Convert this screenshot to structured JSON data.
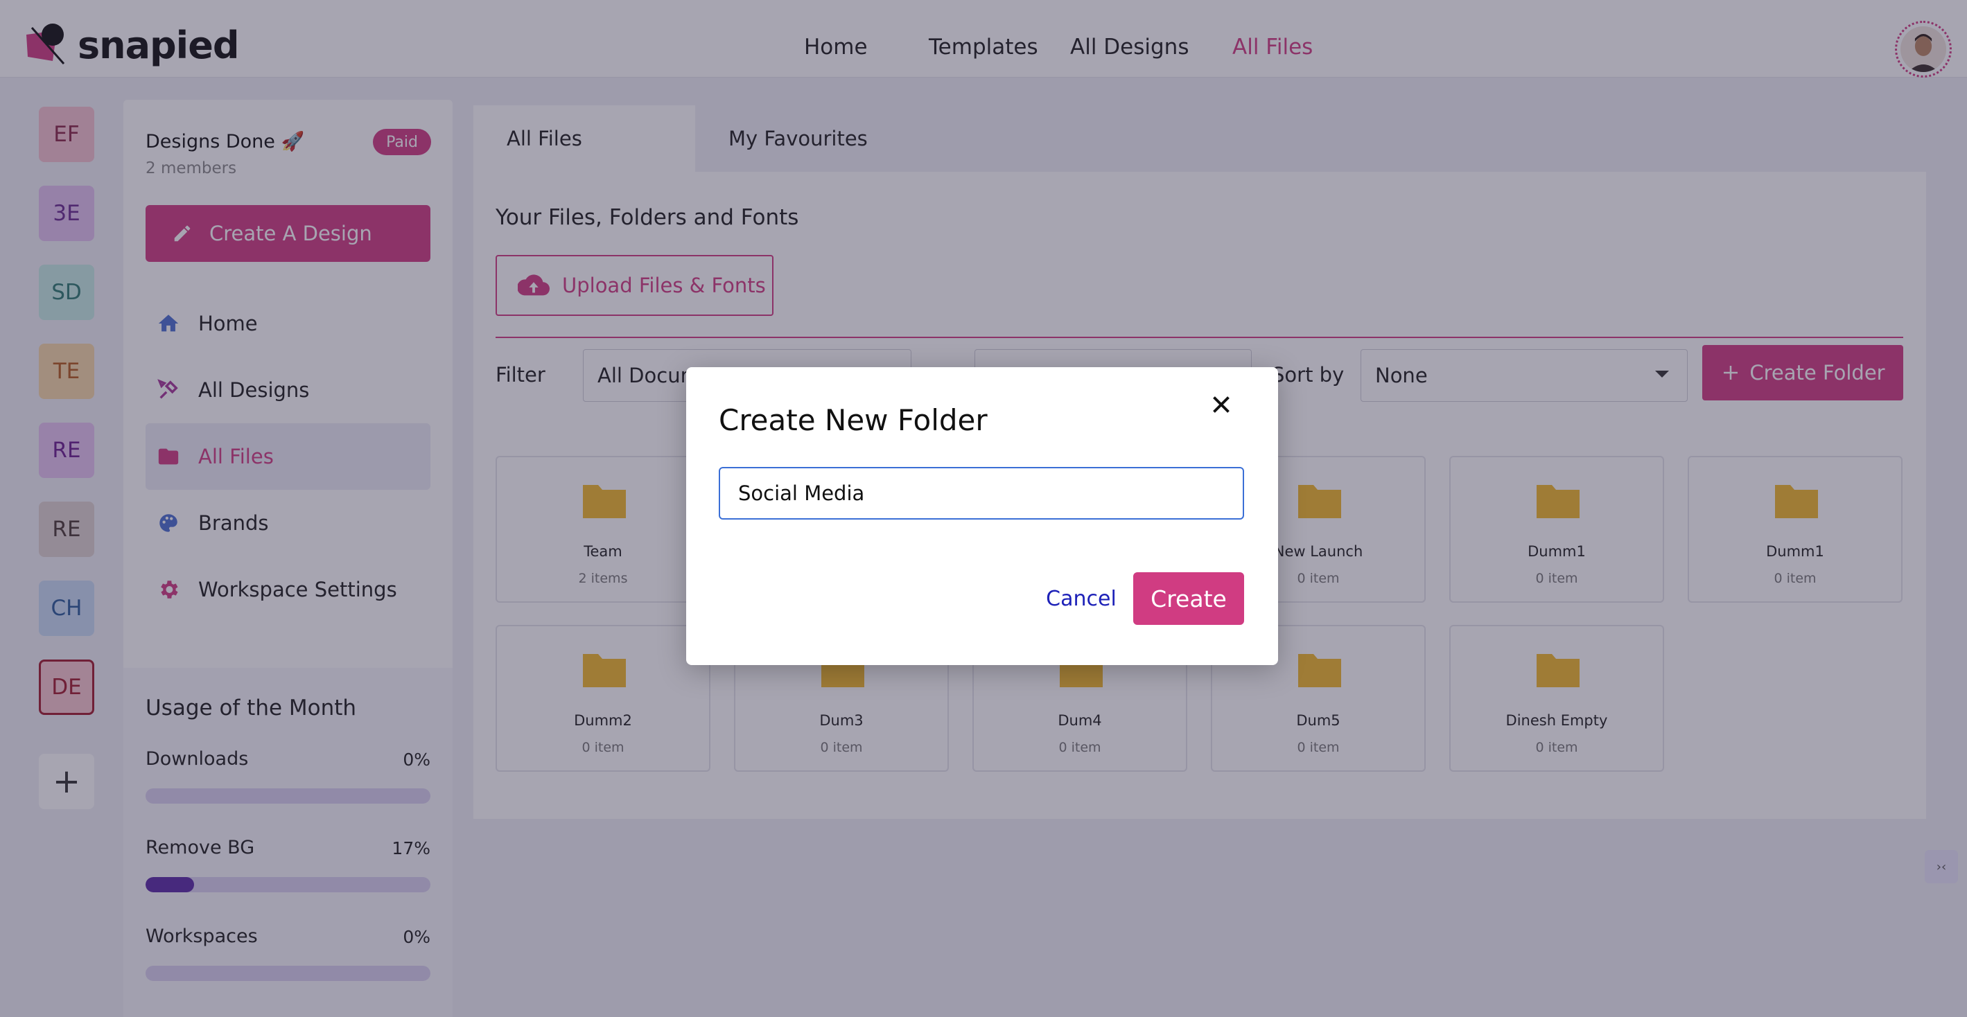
{
  "brand": {
    "name": "snapied"
  },
  "nav": {
    "links": [
      "Home",
      "Templates",
      "All Designs",
      "All Files"
    ],
    "active": "All Files"
  },
  "workspaces": [
    {
      "initials": "EF",
      "bg": "#f4c2cf",
      "fg": "#8a2748"
    },
    {
      "initials": "3E",
      "bg": "#e2c2f0",
      "fg": "#6a2a90"
    },
    {
      "initials": "SD",
      "bg": "#c6ece6",
      "fg": "#2e7a70"
    },
    {
      "initials": "TE",
      "bg": "#f7d7a8",
      "fg": "#b35a1d"
    },
    {
      "initials": "RE",
      "bg": "#e5c3f2",
      "fg": "#6b1e8f"
    },
    {
      "initials": "RE",
      "bg": "#dfd2d0",
      "fg": "#4a3a36"
    },
    {
      "initials": "CH",
      "bg": "#c8dbf4",
      "fg": "#2a5b9a"
    },
    {
      "initials": "DE",
      "bg": "#f8c6cf",
      "fg": "#a01a2e"
    }
  ],
  "sidebar": {
    "workspace_name": "Designs Done 🚀",
    "members": "2 members",
    "plan_badge": "Paid",
    "create_button": "Create A Design",
    "items": [
      {
        "label": "Home",
        "icon": "home-icon"
      },
      {
        "label": "All Designs",
        "icon": "design-tools-icon"
      },
      {
        "label": "All Files",
        "icon": "folder-icon"
      },
      {
        "label": "Brands",
        "icon": "palette-icon"
      },
      {
        "label": "Workspace Settings",
        "icon": "gear-icon"
      }
    ],
    "usage": {
      "title": "Usage of the Month",
      "rows": [
        {
          "label": "Downloads",
          "percent": "0%",
          "value": 0
        },
        {
          "label": "Remove BG",
          "percent": "17%",
          "value": 17
        },
        {
          "label": "Workspaces",
          "percent": "0%",
          "value": 0
        }
      ]
    }
  },
  "main": {
    "tabs": [
      "All Files",
      "My Favourites"
    ],
    "section_title": "Your Files, Folders and Fonts",
    "upload_button": "Upload Files & Fonts",
    "filter_label": "Filter",
    "filter_value": "All Documents",
    "sort_label": "Sort by",
    "sort_value": "None",
    "create_folder_button": "Create Folder",
    "folders": [
      {
        "name": "Team",
        "count": "2 items"
      },
      {
        "name": "",
        "count": ""
      },
      {
        "name": "",
        "count": ""
      },
      {
        "name": "New Launch",
        "count": "0 item"
      },
      {
        "name": "Dumm1",
        "count": "0 item"
      },
      {
        "name": "Dumm1",
        "count": "0 item"
      },
      {
        "name": "Dumm2",
        "count": "0 item"
      },
      {
        "name": "Dum3",
        "count": "0 item"
      },
      {
        "name": "Dum4",
        "count": "0 item"
      },
      {
        "name": "Dum5",
        "count": "0 item"
      },
      {
        "name": "Dinesh Empty",
        "count": "0 item"
      }
    ]
  },
  "modal": {
    "title": "Create New Folder",
    "input_value": "Social Media",
    "cancel": "Cancel",
    "create": "Create"
  },
  "colors": {
    "accent": "#d03c82",
    "folder": "#f2b92b",
    "usage_fill": "#5b2aa6"
  }
}
